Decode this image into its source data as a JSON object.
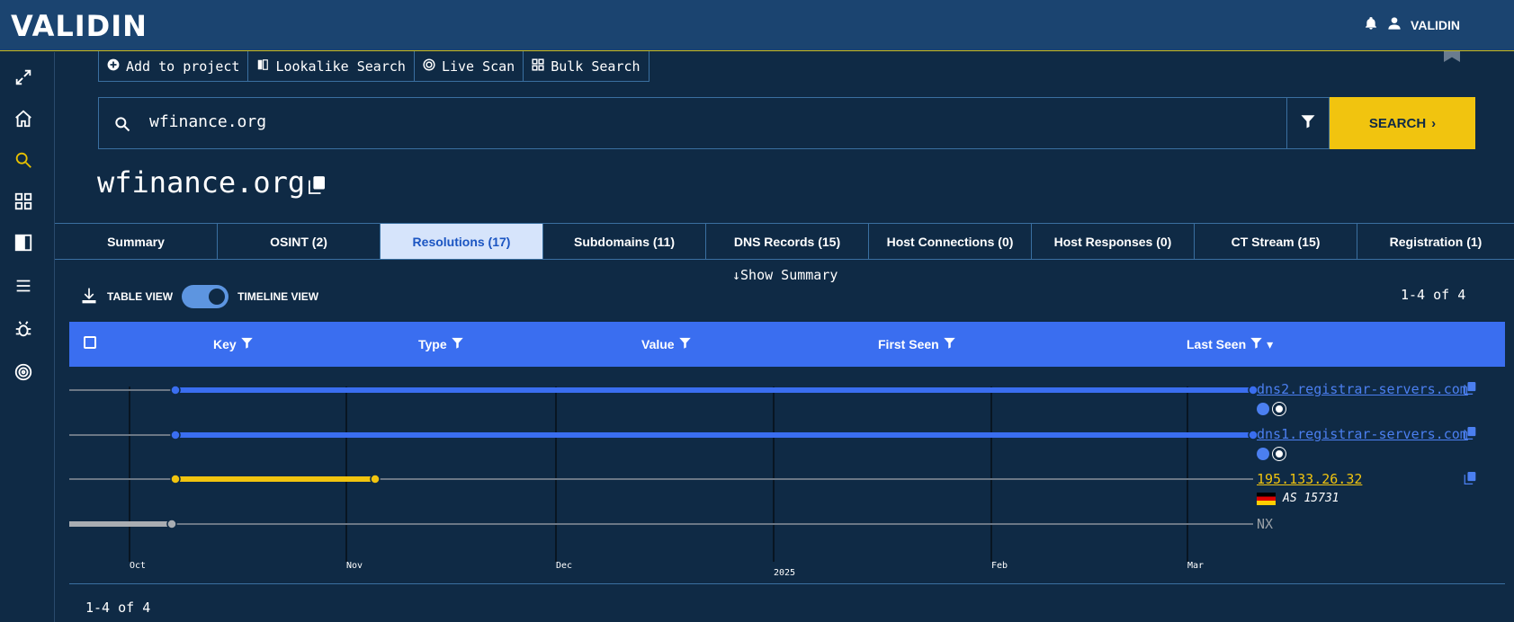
{
  "app": {
    "logo": "VALIDIN",
    "user": "VALIDIN"
  },
  "toolbar": {
    "add_project": "Add to project",
    "lookalike": "Lookalike Search",
    "live_scan": "Live Scan",
    "bulk_search": "Bulk Search"
  },
  "search": {
    "value": "wfinance.org",
    "button": "SEARCH"
  },
  "page": {
    "title": "wfinance.org"
  },
  "tabs": [
    {
      "label": "Summary"
    },
    {
      "label": "OSINT (2)"
    },
    {
      "label": "Resolutions (17)"
    },
    {
      "label": "Subdomains (11)"
    },
    {
      "label": "DNS Records (15)"
    },
    {
      "label": "Host Connections (0)"
    },
    {
      "label": "Host Responses (0)"
    },
    {
      "label": "CT Stream (15)"
    },
    {
      "label": "Registration (1)"
    }
  ],
  "view": {
    "show_summary": "Show Summary",
    "table_view": "TABLE VIEW",
    "timeline_view": "TIMELINE VIEW",
    "pager": "1-4 of 4"
  },
  "columns": {
    "key": "Key",
    "type": "Type",
    "value": "Value",
    "first_seen": "First Seen",
    "last_seen": "Last Seen"
  },
  "timeline": {
    "rows": [
      {
        "value": "dns2.registrar-servers.com",
        "color": "#3a6ef0"
      },
      {
        "value": "dns1.registrar-servers.com",
        "color": "#3a6ef0"
      },
      {
        "value": "195.133.26.32",
        "color": "#f1c40f",
        "asn": "AS 15731"
      },
      {
        "value": "NX",
        "color": "#9aa0a6"
      }
    ],
    "axis": {
      "oct": "Oct",
      "nov": "Nov",
      "dec": "Dec",
      "year": "2025",
      "feb": "Feb",
      "mar": "Mar"
    }
  },
  "footer": {
    "pager": "1-4 of 4"
  }
}
